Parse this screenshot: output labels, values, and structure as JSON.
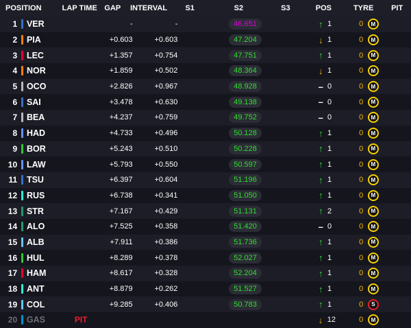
{
  "colors": {
    "background": "#15151e",
    "row_alt": "#1d1d27",
    "header_bg": "#1e1e28",
    "purple": "#e000e0",
    "green": "#2ee02e",
    "up_arrow": "#2ee02e",
    "down_arrow": "#f5b800",
    "pit": "#e8202a",
    "tyre_count": "#f5b800",
    "medium": "#f5d000",
    "soft": "#e8202a"
  },
  "header": {
    "position": "POSITION",
    "lap_time": "LAP TIME",
    "gap": "GAP",
    "interval": "INTERVAL",
    "s1": "S1",
    "s2": "S2",
    "s3": "S3",
    "pos": "POS",
    "tyre": "TYRE",
    "pit": "PIT"
  },
  "rows": [
    {
      "pos": "1",
      "driver": "VER",
      "team_color": "#3671c6",
      "lap_time": "",
      "gap": "-",
      "interval": "-",
      "s2": "46.651",
      "s2_color": "#e000e0",
      "pos_change_icon": "arrow-up-icon",
      "pos_change_symbol": "↑",
      "pos_change_color": "#2ee02e",
      "pos_change": "1",
      "tyre_count": "0",
      "tyre": "M",
      "tyre_color": "#f5d000"
    },
    {
      "pos": "2",
      "driver": "PIA",
      "team_color": "#ff8000",
      "lap_time": "",
      "gap": "+0.603",
      "interval": "+0.603",
      "s2": "47.204",
      "s2_color": "#2ee02e",
      "pos_change_icon": "arrow-down-icon",
      "pos_change_symbol": "↓",
      "pos_change_color": "#f5b800",
      "pos_change": "1",
      "tyre_count": "0",
      "tyre": "M",
      "tyre_color": "#f5d000"
    },
    {
      "pos": "3",
      "driver": "LEC",
      "team_color": "#e8002d",
      "lap_time": "",
      "gap": "+1.357",
      "interval": "+0.754",
      "s2": "47.751",
      "s2_color": "#2ee02e",
      "pos_change_icon": "arrow-up-icon",
      "pos_change_symbol": "↑",
      "pos_change_color": "#2ee02e",
      "pos_change": "1",
      "tyre_count": "0",
      "tyre": "M",
      "tyre_color": "#f5d000"
    },
    {
      "pos": "4",
      "driver": "NOR",
      "team_color": "#ff8000",
      "lap_time": "",
      "gap": "+1.859",
      "interval": "+0.502",
      "s2": "48.364",
      "s2_color": "#2ee02e",
      "pos_change_icon": "arrow-down-icon",
      "pos_change_symbol": "↓",
      "pos_change_color": "#f5b800",
      "pos_change": "1",
      "tyre_count": "0",
      "tyre": "M",
      "tyre_color": "#f5d000"
    },
    {
      "pos": "5",
      "driver": "OCO",
      "team_color": "#b6babd",
      "lap_time": "",
      "gap": "+2.826",
      "interval": "+0.967",
      "s2": "48.928",
      "s2_color": "#2ee02e",
      "pos_change_icon": "dash-icon",
      "pos_change_symbol": "–",
      "pos_change_color": "#ffffff",
      "pos_change": "0",
      "tyre_count": "0",
      "tyre": "M",
      "tyre_color": "#f5d000"
    },
    {
      "pos": "6",
      "driver": "SAI",
      "team_color": "#3671c6",
      "lap_time": "",
      "gap": "+3.478",
      "interval": "+0.630",
      "s2": "49.138",
      "s2_color": "#2ee02e",
      "pos_change_icon": "dash-icon",
      "pos_change_symbol": "–",
      "pos_change_color": "#ffffff",
      "pos_change": "0",
      "tyre_count": "0",
      "tyre": "M",
      "tyre_color": "#f5d000"
    },
    {
      "pos": "7",
      "driver": "BEA",
      "team_color": "#b6babd",
      "lap_time": "",
      "gap": "+4.237",
      "interval": "+0.759",
      "s2": "49.752",
      "s2_color": "#2ee02e",
      "pos_change_icon": "dash-icon",
      "pos_change_symbol": "–",
      "pos_change_color": "#ffffff",
      "pos_change": "0",
      "tyre_count": "0",
      "tyre": "M",
      "tyre_color": "#f5d000"
    },
    {
      "pos": "8",
      "driver": "HAD",
      "team_color": "#6692ff",
      "lap_time": "",
      "gap": "+4.733",
      "interval": "+0.496",
      "s2": "50.128",
      "s2_color": "#2ee02e",
      "pos_change_icon": "arrow-up-icon",
      "pos_change_symbol": "↑",
      "pos_change_color": "#2ee02e",
      "pos_change": "1",
      "tyre_count": "0",
      "tyre": "M",
      "tyre_color": "#f5d000"
    },
    {
      "pos": "9",
      "driver": "BOR",
      "team_color": "#2dc832",
      "lap_time": "",
      "gap": "+5.243",
      "interval": "+0.510",
      "s2": "50.228",
      "s2_color": "#2ee02e",
      "pos_change_icon": "arrow-up-icon",
      "pos_change_symbol": "↑",
      "pos_change_color": "#2ee02e",
      "pos_change": "1",
      "tyre_count": "0",
      "tyre": "M",
      "tyre_color": "#f5d000"
    },
    {
      "pos": "10",
      "driver": "LAW",
      "team_color": "#6692ff",
      "lap_time": "",
      "gap": "+5.793",
      "interval": "+0.550",
      "s2": "50.597",
      "s2_color": "#2ee02e",
      "pos_change_icon": "arrow-up-icon",
      "pos_change_symbol": "↑",
      "pos_change_color": "#2ee02e",
      "pos_change": "1",
      "tyre_count": "0",
      "tyre": "M",
      "tyre_color": "#f5d000"
    },
    {
      "pos": "11",
      "driver": "TSU",
      "team_color": "#3671c6",
      "lap_time": "",
      "gap": "+6.397",
      "interval": "+0.604",
      "s2": "51.196",
      "s2_color": "#2ee02e",
      "pos_change_icon": "arrow-up-icon",
      "pos_change_symbol": "↑",
      "pos_change_color": "#2ee02e",
      "pos_change": "1",
      "tyre_count": "0",
      "tyre": "M",
      "tyre_color": "#f5d000"
    },
    {
      "pos": "12",
      "driver": "RUS",
      "team_color": "#27f4d2",
      "lap_time": "",
      "gap": "+6.738",
      "interval": "+0.341",
      "s2": "51.050",
      "s2_color": "#2ee02e",
      "pos_change_icon": "arrow-up-icon",
      "pos_change_symbol": "↑",
      "pos_change_color": "#2ee02e",
      "pos_change": "1",
      "tyre_count": "0",
      "tyre": "M",
      "tyre_color": "#f5d000"
    },
    {
      "pos": "13",
      "driver": "STR",
      "team_color": "#229971",
      "lap_time": "",
      "gap": "+7.167",
      "interval": "+0.429",
      "s2": "51.131",
      "s2_color": "#2ee02e",
      "pos_change_icon": "arrow-up-icon",
      "pos_change_symbol": "↑",
      "pos_change_color": "#2ee02e",
      "pos_change": "2",
      "tyre_count": "0",
      "tyre": "M",
      "tyre_color": "#f5d000"
    },
    {
      "pos": "14",
      "driver": "ALO",
      "team_color": "#229971",
      "lap_time": "",
      "gap": "+7.525",
      "interval": "+0.358",
      "s2": "51.420",
      "s2_color": "#2ee02e",
      "pos_change_icon": "dash-icon",
      "pos_change_symbol": "–",
      "pos_change_color": "#ffffff",
      "pos_change": "0",
      "tyre_count": "0",
      "tyre": "M",
      "tyre_color": "#f5d000"
    },
    {
      "pos": "15",
      "driver": "ALB",
      "team_color": "#64c4ff",
      "lap_time": "",
      "gap": "+7.911",
      "interval": "+0.386",
      "s2": "51.736",
      "s2_color": "#2ee02e",
      "pos_change_icon": "arrow-up-icon",
      "pos_change_symbol": "↑",
      "pos_change_color": "#2ee02e",
      "pos_change": "1",
      "tyre_count": "0",
      "tyre": "M",
      "tyre_color": "#f5d000"
    },
    {
      "pos": "16",
      "driver": "HUL",
      "team_color": "#2dc832",
      "lap_time": "",
      "gap": "+8.289",
      "interval": "+0.378",
      "s2": "52.027",
      "s2_color": "#2ee02e",
      "pos_change_icon": "arrow-up-icon",
      "pos_change_symbol": "↑",
      "pos_change_color": "#2ee02e",
      "pos_change": "1",
      "tyre_count": "0",
      "tyre": "M",
      "tyre_color": "#f5d000"
    },
    {
      "pos": "17",
      "driver": "HAM",
      "team_color": "#e8002d",
      "lap_time": "",
      "gap": "+8.617",
      "interval": "+0.328",
      "s2": "52.204",
      "s2_color": "#2ee02e",
      "pos_change_icon": "arrow-up-icon",
      "pos_change_symbol": "↑",
      "pos_change_color": "#2ee02e",
      "pos_change": "1",
      "tyre_count": "0",
      "tyre": "M",
      "tyre_color": "#f5d000"
    },
    {
      "pos": "18",
      "driver": "ANT",
      "team_color": "#27f4d2",
      "lap_time": "",
      "gap": "+8.879",
      "interval": "+0.262",
      "s2": "51.527",
      "s2_color": "#2ee02e",
      "pos_change_icon": "arrow-up-icon",
      "pos_change_symbol": "↑",
      "pos_change_color": "#2ee02e",
      "pos_change": "1",
      "tyre_count": "0",
      "tyre": "M",
      "tyre_color": "#f5d000"
    },
    {
      "pos": "19",
      "driver": "COL",
      "team_color": "#64c4ff",
      "lap_time": "",
      "gap": "+9.285",
      "interval": "+0.406",
      "s2": "50.783",
      "s2_color": "#2ee02e",
      "pos_change_icon": "arrow-up-icon",
      "pos_change_symbol": "↑",
      "pos_change_color": "#2ee02e",
      "pos_change": "1",
      "tyre_count": "0",
      "tyre": "S",
      "tyre_color": "#e8202a"
    },
    {
      "pos": "20",
      "driver": "GAS",
      "team_color": "#0093cc",
      "lap_time": "PIT",
      "gap": "",
      "interval": "",
      "s2": "",
      "s2_color": "",
      "pos_change_icon": "arrow-down-icon",
      "pos_change_symbol": "↓",
      "pos_change_color": "#f5b800",
      "pos_change": "12",
      "tyre_count": "0",
      "tyre": "M",
      "tyre_color": "#f5d000",
      "out": true
    }
  ]
}
